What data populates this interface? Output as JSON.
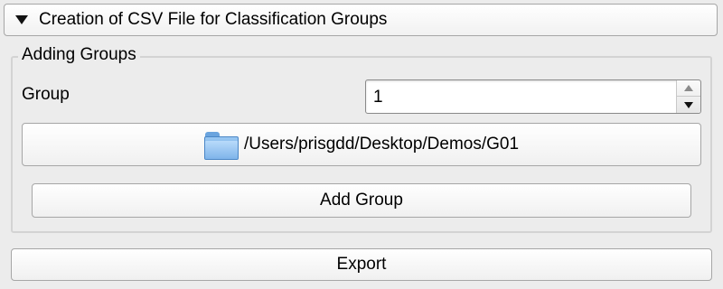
{
  "section": {
    "title": "Creation of CSV File for Classification Groups",
    "expanded": true
  },
  "adding_groups": {
    "legend": "Adding Groups",
    "group_label": "Group",
    "group_value": "1",
    "path": "/Users/prisgdd/Desktop/Demos/G01",
    "path_icon": "folder-icon",
    "add_button_label": "Add Group"
  },
  "export": {
    "label": "Export"
  }
}
